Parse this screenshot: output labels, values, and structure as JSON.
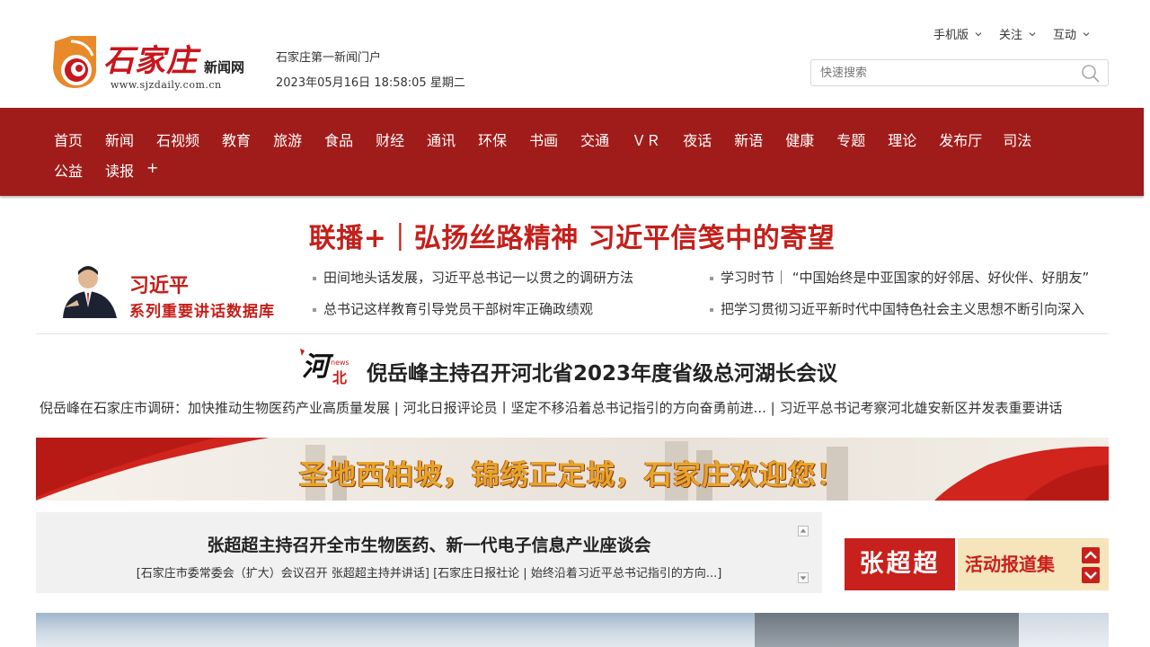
{
  "header": {
    "logo_title": "石家庄",
    "logo_sub": "新闻网",
    "logo_url": "www.sjzdaily.com.cn",
    "tagline": "石家庄第一新闻门户",
    "datetime": "2023年05月16日 18:58:05 星期二",
    "top_nav": [
      {
        "label": "手机版"
      },
      {
        "label": "关注"
      },
      {
        "label": "互动"
      }
    ],
    "search": {
      "placeholder": "快速搜索"
    }
  },
  "main_nav": {
    "row1": [
      "首页",
      "新闻",
      "石视频",
      "教育",
      "旅游",
      "食品",
      "财经",
      "通讯",
      "环保",
      "书画",
      "交通",
      "ＶＲ",
      "夜话",
      "新语",
      "健康",
      "专题",
      "理论",
      "发布厅",
      "司法"
    ],
    "row2": [
      "公益",
      "读报",
      "+"
    ]
  },
  "headline": "联播+｜弘扬丝路精神 习近平信笺中的寄望",
  "xi_section": {
    "name": "习近平",
    "subtitle": "系列重要讲话数据库",
    "links_col1": [
      "田间地头话发展，习近平总书记一以贯之的调研方法",
      "总书记这样教育引导党员干部树牢正确政绩观"
    ],
    "links_col2": [
      "学习时节｜ “中国始终是中亚国家的好邻居、好伙伴、好朋友”",
      "把学习贯彻习近平新时代中国特色社会主义思想不断引向深入"
    ]
  },
  "hebei": {
    "logo_char": "河北",
    "logo_news": "news",
    "title": "倪岳峰主持召开河北省2023年度省级总河湖长会议",
    "links": "倪岳峰在石家庄市调研：加快推动生物医药产业高质量发展 | 河北日报评论员丨坚定不移沿着总书记指引的方向奋勇前进... | 习近平总书记考察河北雄安新区并发表重要讲话"
  },
  "slogan": "圣地西柏坡，锦绣正定城，石家庄欢迎您！",
  "news_box": {
    "title": "张超超主持召开全市生物医药、新一代电子信息产业座谈会",
    "sub": "[石家庄市委常委会（扩大）会议召开 张超超主持并讲话] [石家庄日报社论 | 始终沿着习近平总书记指引的方向...]"
  },
  "zhang_banner": {
    "left": "张超超",
    "right": "活动报道集"
  },
  "colors": {
    "nav_red": "#a01c1a",
    "headline_red": "#c41f1a"
  }
}
